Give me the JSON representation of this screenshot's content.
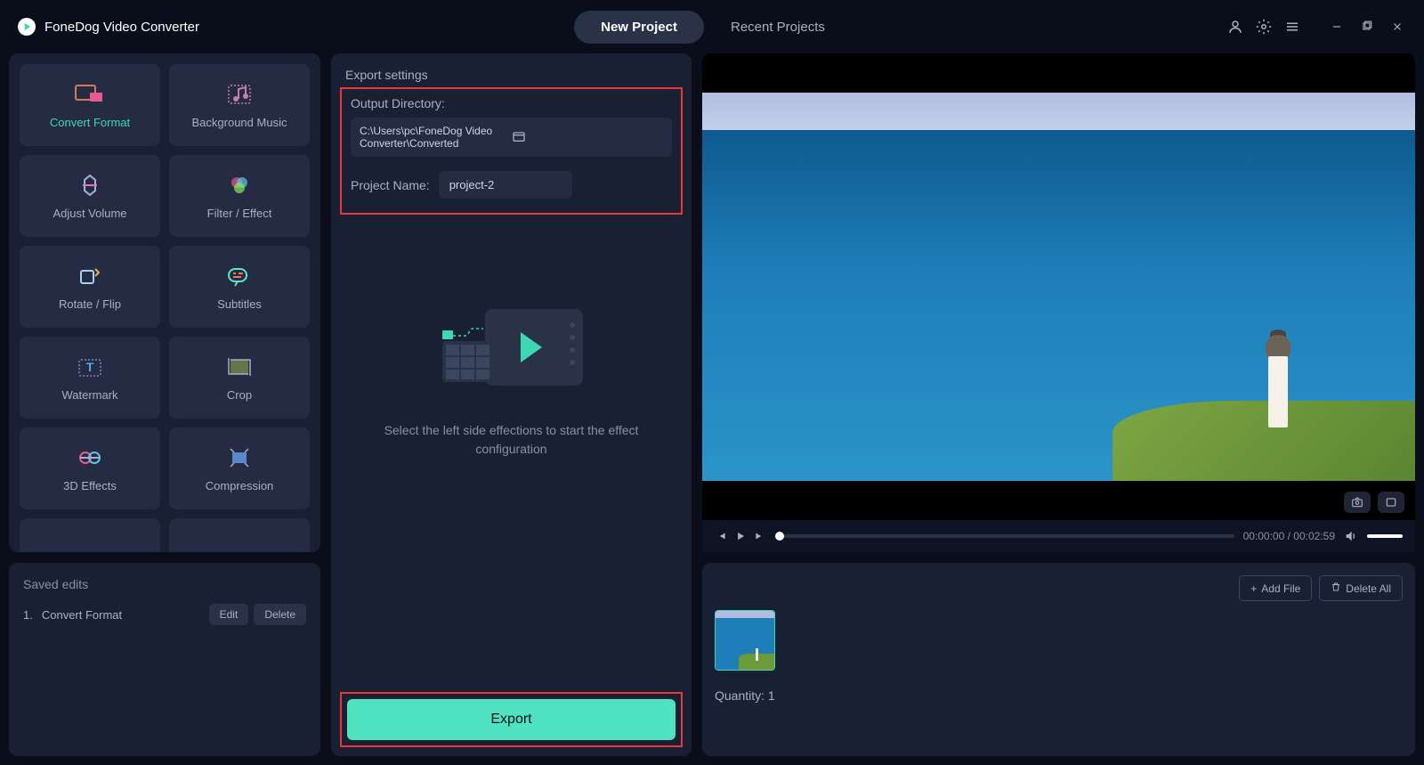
{
  "app": {
    "title": "FoneDog Video Converter"
  },
  "tabs": {
    "new_project": "New Project",
    "recent_projects": "Recent Projects"
  },
  "tools": [
    {
      "label": "Convert Format",
      "icon": "convert-icon",
      "active": true
    },
    {
      "label": "Background Music",
      "icon": "music-icon"
    },
    {
      "label": "Adjust Volume",
      "icon": "volume-icon"
    },
    {
      "label": "Filter / Effect",
      "icon": "filter-icon"
    },
    {
      "label": "Rotate / Flip",
      "icon": "rotate-icon"
    },
    {
      "label": "Subtitles",
      "icon": "subtitles-icon"
    },
    {
      "label": "Watermark",
      "icon": "watermark-icon"
    },
    {
      "label": "Crop",
      "icon": "crop-icon"
    },
    {
      "label": "3D Effects",
      "icon": "3d-icon"
    },
    {
      "label": "Compression",
      "icon": "compress-icon"
    }
  ],
  "saved_edits": {
    "title": "Saved edits",
    "items": [
      {
        "index": "1.",
        "label": "Convert Format"
      }
    ],
    "edit_btn": "Edit",
    "delete_btn": "Delete"
  },
  "export": {
    "title": "Export settings",
    "output_label": "Output Directory:",
    "output_path": "C:\\Users\\pc\\FoneDog Video Converter\\Converted",
    "project_label": "Project Name:",
    "project_value": "project-2",
    "hint": "Select the left side effections to start the effect configuration",
    "export_btn": "Export"
  },
  "playback": {
    "time_display": "00:00:00 / 00:02:59"
  },
  "files": {
    "add_file": "Add File",
    "delete_all": "Delete All",
    "quantity_label_prefix": "Quantity: ",
    "quantity": "1"
  }
}
